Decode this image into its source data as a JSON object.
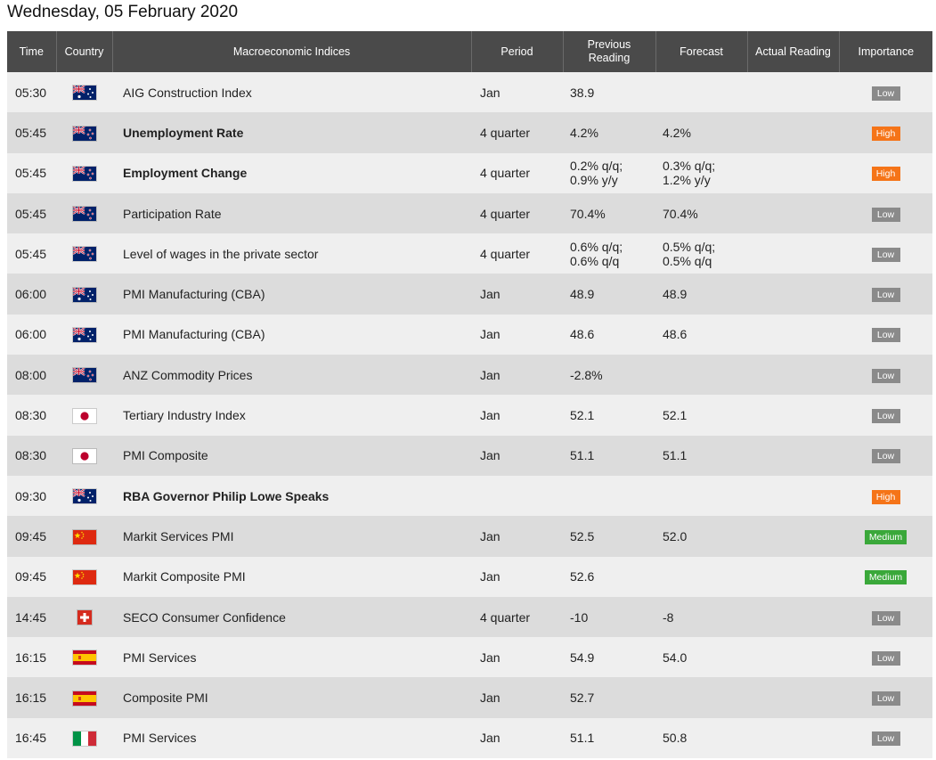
{
  "page": {
    "title": "Wednesday, 05 February 2020"
  },
  "table": {
    "headers": {
      "time": "Time",
      "country": "Country",
      "indices": "Macroeconomic Indices",
      "period": "Period",
      "previous": "Previous Reading",
      "forecast": "Forecast",
      "actual": "Actual Reading",
      "importance": "Importance"
    },
    "rows": [
      {
        "time": "05:30",
        "country": "australia",
        "name": "AIG Construction Index",
        "bold": false,
        "period": "Jan",
        "prev": "38.9",
        "forecast": "",
        "actual": "",
        "importance": "Low"
      },
      {
        "time": "05:45",
        "country": "new-zealand",
        "name": "Unemployment Rate",
        "bold": true,
        "period": "4 quarter",
        "prev": "4.2%",
        "forecast": "4.2%",
        "actual": "",
        "importance": "High"
      },
      {
        "time": "05:45",
        "country": "new-zealand",
        "name": "Employment Change",
        "bold": true,
        "period": "4 quarter",
        "prev": "0.2% q/q;\n0.9% y/y",
        "forecast": "0.3% q/q;\n1.2% y/y",
        "actual": "",
        "importance": "High"
      },
      {
        "time": "05:45",
        "country": "new-zealand",
        "name": "Participation Rate",
        "bold": false,
        "period": "4 quarter",
        "prev": "70.4%",
        "forecast": "70.4%",
        "actual": "",
        "importance": "Low"
      },
      {
        "time": "05:45",
        "country": "new-zealand",
        "name": "Level of wages in the private sector",
        "bold": false,
        "period": "4 quarter",
        "prev": "0.6% q/q;\n0.6% q/q",
        "forecast": "0.5% q/q;\n0.5% q/q",
        "actual": "",
        "importance": "Low"
      },
      {
        "time": "06:00",
        "country": "australia",
        "name": "PMI Manufacturing (CBA)",
        "bold": false,
        "period": "Jan",
        "prev": "48.9",
        "forecast": "48.9",
        "actual": "",
        "importance": "Low"
      },
      {
        "time": "06:00",
        "country": "australia",
        "name": "PMI Manufacturing (CBA)",
        "bold": false,
        "period": "Jan",
        "prev": "48.6",
        "forecast": "48.6",
        "actual": "",
        "importance": "Low"
      },
      {
        "time": "08:00",
        "country": "new-zealand",
        "name": "ANZ Commodity Prices",
        "bold": false,
        "period": "Jan",
        "prev": "-2.8%",
        "forecast": "",
        "actual": "",
        "importance": "Low"
      },
      {
        "time": "08:30",
        "country": "japan",
        "name": "Tertiary Industry Index",
        "bold": false,
        "period": "Jan",
        "prev": "52.1",
        "forecast": "52.1",
        "actual": "",
        "importance": "Low"
      },
      {
        "time": "08:30",
        "country": "japan",
        "name": "PMI Composite",
        "bold": false,
        "period": "Jan",
        "prev": "51.1",
        "forecast": "51.1",
        "actual": "",
        "importance": "Low"
      },
      {
        "time": "09:30",
        "country": "australia",
        "name": "RBA Governor Philip Lowe Speaks",
        "bold": true,
        "period": "",
        "prev": "",
        "forecast": "",
        "actual": "",
        "importance": "High"
      },
      {
        "time": "09:45",
        "country": "china",
        "name": "Markit Services PMI",
        "bold": false,
        "period": "Jan",
        "prev": "52.5",
        "forecast": "52.0",
        "actual": "",
        "importance": "Medium"
      },
      {
        "time": "09:45",
        "country": "china",
        "name": "Markit Composite PMI",
        "bold": false,
        "period": "Jan",
        "prev": "52.6",
        "forecast": "",
        "actual": "",
        "importance": "Medium"
      },
      {
        "time": "14:45",
        "country": "switzerland",
        "name": "SECO Consumer Confidence",
        "bold": false,
        "period": "4 quarter",
        "prev": "-10",
        "forecast": "-8",
        "actual": "",
        "importance": "Low"
      },
      {
        "time": "16:15",
        "country": "spain",
        "name": "PMI Services",
        "bold": false,
        "period": "Jan",
        "prev": "54.9",
        "forecast": "54.0",
        "actual": "",
        "importance": "Low"
      },
      {
        "time": "16:15",
        "country": "spain",
        "name": "Composite PMI",
        "bold": false,
        "period": "Jan",
        "prev": "52.7",
        "forecast": "",
        "actual": "",
        "importance": "Low"
      },
      {
        "time": "16:45",
        "country": "italy",
        "name": "PMI Services",
        "bold": false,
        "period": "Jan",
        "prev": "51.1",
        "forecast": "50.8",
        "actual": "",
        "importance": "Low"
      }
    ]
  },
  "colors": {
    "header_bg": "#4a4a4a",
    "row_light": "#efefef",
    "row_dark": "#dcdcdc",
    "low": "#8a8a8a",
    "high": "#f57418",
    "medium": "#3aa83a"
  }
}
